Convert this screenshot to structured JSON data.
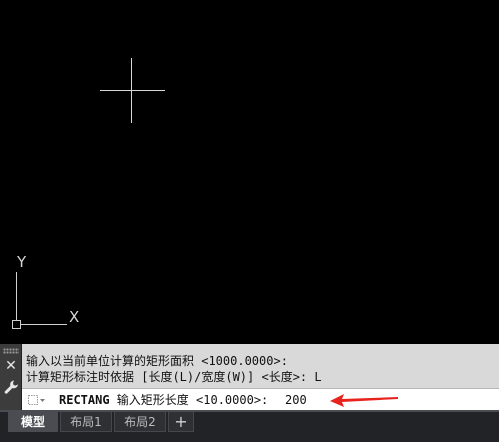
{
  "canvas": {
    "ucs_y_label": "Y",
    "ucs_x_label": "X"
  },
  "command_window": {
    "history": [
      "输入以当前单位计算的矩形面积 <1000.0000>:",
      "计算矩形标注时依据 [长度(L)/宽度(W)] <长度>: L"
    ],
    "command_name": "RECTANG",
    "prompt": " 输入矩形长度 <10.0000>:",
    "input_value": "200",
    "arrow_color": "#e8231d"
  },
  "tabs": [
    {
      "label": "模型",
      "active": true
    },
    {
      "label": "布局1",
      "active": false
    },
    {
      "label": "布局2",
      "active": false
    }
  ],
  "add_tab_label": "+"
}
